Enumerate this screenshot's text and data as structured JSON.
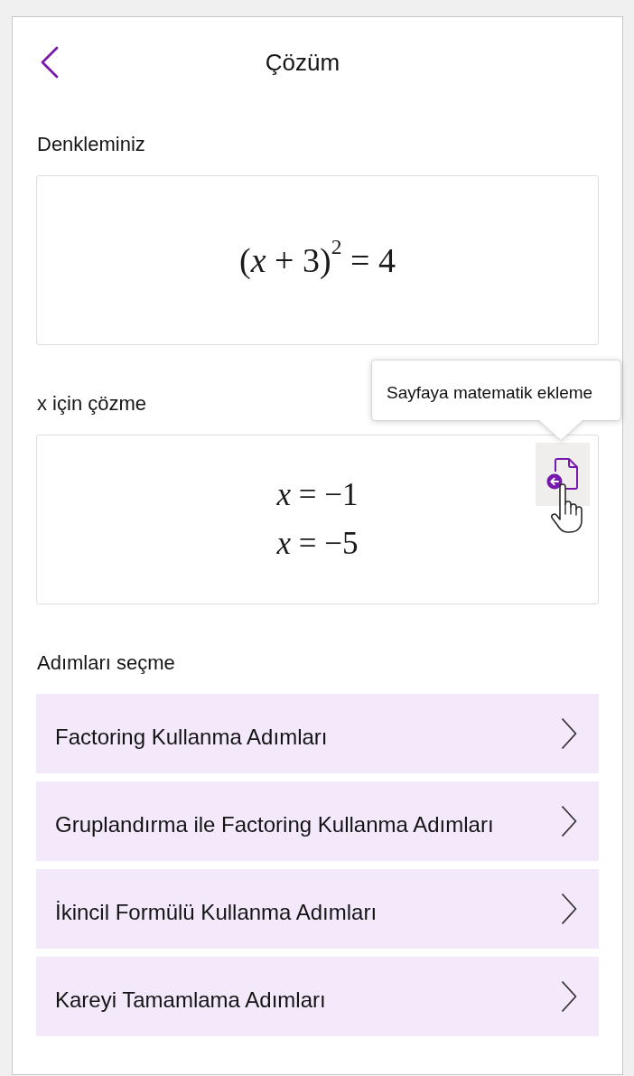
{
  "header": {
    "title": "Çözüm"
  },
  "equation": {
    "label": "Denkleminiz",
    "expression": "(*x* + 3)$^{2}$ = 4"
  },
  "solution": {
    "label": "x için çözme",
    "lines": [
      "*x* = −1",
      "*x* = −5"
    ],
    "tooltip": "Sayfaya matematik ekleme"
  },
  "steps": {
    "label": "Adımları seçme",
    "items": [
      "Factoring Kullanma Adımları",
      "Gruplandırma ile Factoring Kullanma Adımları",
      "İkincil Formülü Kullanma Adımları",
      "Kareyi Tamamlama Adımları"
    ]
  }
}
